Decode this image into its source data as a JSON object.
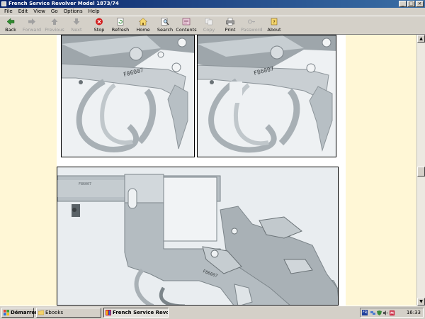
{
  "window": {
    "title": "French Service Revolver Model 1873/74",
    "controls": {
      "minimize": "_",
      "maximize": "□",
      "close": "×"
    }
  },
  "menu": [
    "File",
    "Edit",
    "View",
    "Go",
    "Options",
    "Help"
  ],
  "toolbar": {
    "buttons": [
      {
        "label": "Back",
        "icon": "back-arrow-icon",
        "enabled": true
      },
      {
        "label": "Forward",
        "icon": "forward-arrow-icon",
        "enabled": false
      },
      {
        "label": "Previous",
        "icon": "up-arrow-icon",
        "enabled": false
      },
      {
        "label": "Next",
        "icon": "down-arrow-icon",
        "enabled": false
      },
      {
        "label": "Stop",
        "icon": "stop-icon",
        "enabled": true
      },
      {
        "label": "Refresh",
        "icon": "refresh-icon",
        "enabled": true
      },
      {
        "label": "Home",
        "icon": "home-icon",
        "enabled": true
      },
      {
        "label": "Search",
        "icon": "search-icon",
        "enabled": true
      },
      {
        "label": "Contents",
        "icon": "contents-icon",
        "enabled": true
      },
      {
        "label": "Copy",
        "icon": "copy-icon",
        "enabled": false
      },
      {
        "label": "Print",
        "icon": "print-icon",
        "enabled": true
      },
      {
        "label": "Password",
        "icon": "password-icon",
        "enabled": false
      },
      {
        "label": "About",
        "icon": "about-icon",
        "enabled": true
      }
    ]
  },
  "photos": {
    "serial_left": "F86007",
    "serial_right": "F86007",
    "serial_bottom": "F86007",
    "barrel_stamp": "F86007"
  },
  "taskbar": {
    "start_label": "Démarrer",
    "tasks": [
      {
        "label": "Ebooks",
        "active": false
      },
      {
        "label": "French Service Revol...",
        "active": true
      }
    ],
    "tray": {
      "language": "FR",
      "clock": "16:33"
    }
  },
  "colors": {
    "titlebar": "#0a246a",
    "page_margin": "#fff7d6",
    "chrome": "#d4d0c8"
  }
}
